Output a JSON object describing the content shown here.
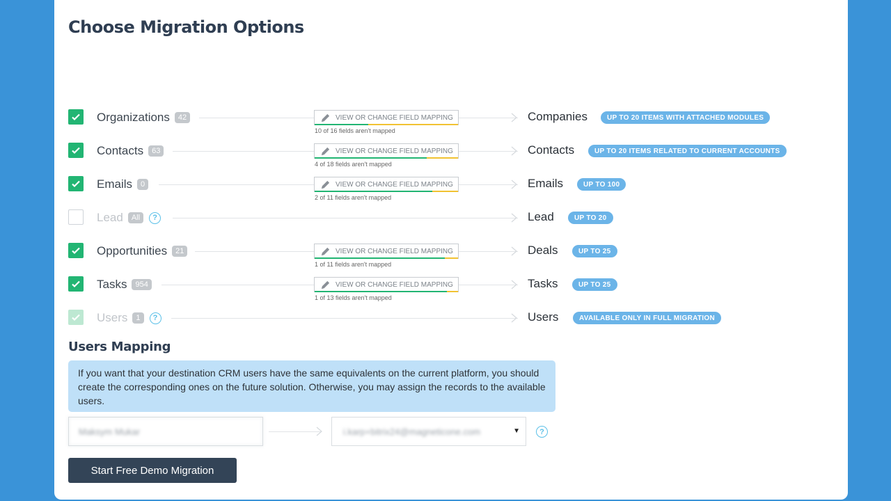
{
  "title": "Choose Migration Options",
  "map_button_label": "VIEW OR CHANGE FIELD MAPPING",
  "rows": [
    {
      "source": "Organizations",
      "count": "42",
      "target": "Companies",
      "badge": "UP TO 20 ITEMS WITH ATTACHED MODULES",
      "checked": true,
      "note": "10 of 16 fields aren't mapped",
      "mapped_fraction": 0.375
    },
    {
      "source": "Contacts",
      "count": "63",
      "target": "Contacts",
      "badge": "UP TO 20 ITEMS RELATED TO CURRENT ACCOUNTS",
      "checked": true,
      "note": "4 of 18 fields aren't mapped",
      "mapped_fraction": 0.78
    },
    {
      "source": "Emails",
      "count": "0",
      "target": "Emails",
      "badge": "UP TO 100",
      "checked": true,
      "note": "2 of 11 fields aren't mapped",
      "mapped_fraction": 0.82
    },
    {
      "source": "Lead",
      "count": "All",
      "target": "Lead",
      "badge": "UP TO 20",
      "checked": false
    },
    {
      "source": "Opportunities",
      "count": "21",
      "target": "Deals",
      "badge": "UP TO 25",
      "checked": true,
      "note": "1 of 11 fields aren't mapped",
      "mapped_fraction": 0.91
    },
    {
      "source": "Tasks",
      "count": "954",
      "target": "Tasks",
      "badge": "UP TO 25",
      "checked": true,
      "note": "1 of 13 fields aren't mapped",
      "mapped_fraction": 0.92
    },
    {
      "source": "Users",
      "count": "1",
      "target": "Users",
      "badge": "AVAILABLE ONLY IN FULL MIGRATION",
      "checked": true
    }
  ],
  "users_mapping": {
    "title": "Users Mapping",
    "info": "If you want that your destination CRM users have the same equivalents on the current platform, you should create the corresponding ones on the future solution. Otherwise, you may assign the records to the available users.",
    "source_user": "Maksym Mukar",
    "target_user": "i.karp+bitrix24@magneticone.com"
  },
  "start_button": "Start Free Demo Migration",
  "colors": {
    "accent": "#22b573",
    "badge": "#6bb4e8",
    "background": "#3a93d8",
    "button": "#334457"
  }
}
